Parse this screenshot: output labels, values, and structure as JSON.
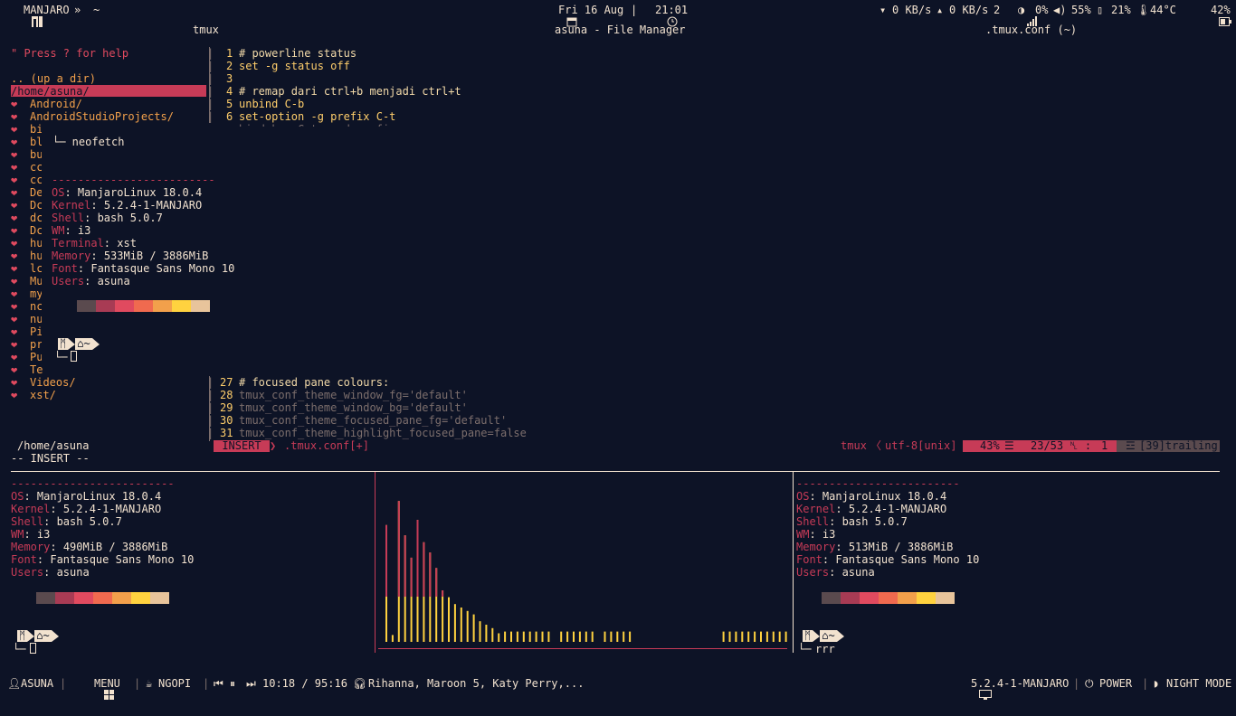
{
  "topbar": {
    "logo": "MANJARO",
    "chevrons": "»",
    "home": "~",
    "date": "Fri 16 Aug",
    "time": "21:01",
    "down_rate": "0 KB/s",
    "up_rate": "0 KB/s",
    "wifi_num": "2",
    "cpu": "0%",
    "volume": "55%",
    "mem": "21%",
    "temp": "44°C",
    "battery": "42%"
  },
  "titles": {
    "left": "tmux",
    "center": "asuna - File Manager",
    "right": ".tmux.conf (~)"
  },
  "file_manager": {
    "help": "\" Press ? for help",
    "updir": ".. (up a dir)",
    "current": "/home/asuna/",
    "entries": [
      "Android/",
      "AndroidStudioProjects/",
      "bi",
      "bl",
      "bu",
      "cc",
      "cc",
      "De",
      "Dc",
      "dc",
      "Dc",
      "hu",
      "hu",
      "lc",
      "Mu",
      "my",
      "nc",
      "nu",
      "Pi",
      "pr",
      "Pu",
      "Te",
      "Videos/",
      "xst/"
    ],
    "footer": "/home/asuna",
    "mode": "-- INSERT --"
  },
  "neofetch_popup": {
    "header": "└─ neofetch",
    "dashes": "-------------------------",
    "rows": [
      {
        "k": "OS",
        "v": "ManjaroLinux 18.0.4"
      },
      {
        "k": "Kernel",
        "v": "5.2.4-1-MANJARO"
      },
      {
        "k": "Shell",
        "v": "bash 5.0.7"
      },
      {
        "k": "WM",
        "v": "i3"
      },
      {
        "k": "Terminal",
        "v": "xst"
      },
      {
        "k": "Memory",
        "v": "533MiB / 3886MiB"
      },
      {
        "k": "Font",
        "v": "Fantasque Sans Mono 10"
      },
      {
        "k": "Users",
        "v": "asuna"
      }
    ],
    "prompt_home": "~",
    "prompt_line": "└─"
  },
  "editor": {
    "lines_top": [
      {
        "n": "1",
        "t": "# powerline status"
      },
      {
        "n": "2",
        "t": "set -g status off"
      },
      {
        "n": "3",
        "t": ""
      },
      {
        "n": "4",
        "t": "# remap dari ctrl+b menjadi ctrl+t"
      },
      {
        "n": "5",
        "t": "unbind C-b"
      },
      {
        "n": "6",
        "t": "set-option -g prefix C-t"
      }
    ],
    "lines_bottom": [
      {
        "n": "27",
        "t": "# focused pane colours:"
      },
      {
        "n": "28",
        "t": "tmux_conf_theme_window_fg='default'"
      },
      {
        "n": "29",
        "t": "tmux_conf_theme_window_bg='default'"
      },
      {
        "n": "30",
        "t": "tmux_conf_theme_focused_pane_fg='default'"
      },
      {
        "n": "31",
        "t": "tmux_conf_theme_highlight_focused_pane=false"
      }
    ],
    "status_mode": "INSERT",
    "status_file": ".tmux.conf[+]",
    "status_ft": "tmux",
    "status_enc": "utf-8[unix]",
    "status_pct": "43%",
    "status_pos": "23/53",
    "status_col": "1",
    "status_trailing": "[39]trailing"
  },
  "pane_left": {
    "dashes": "-------------------------",
    "rows": [
      {
        "k": "OS",
        "v": "ManjaroLinux 18.0.4"
      },
      {
        "k": "Kernel",
        "v": "5.2.4-1-MANJARO"
      },
      {
        "k": "Shell",
        "v": "bash 5.0.7"
      },
      {
        "k": "WM",
        "v": "i3"
      },
      {
        "k": "Memory",
        "v": "490MiB / 3886MiB"
      },
      {
        "k": "Font",
        "v": "Fantasque Sans Mono 10"
      },
      {
        "k": "Users",
        "v": "asuna"
      }
    ],
    "prompt_home": "~",
    "prompt_line": "└─"
  },
  "pane_right": {
    "dashes": "-------------------------",
    "rows": [
      {
        "k": "OS",
        "v": "ManjaroLinux 18.0.4"
      },
      {
        "k": "Kernel",
        "v": "5.2.4-1-MANJARO"
      },
      {
        "k": "Shell",
        "v": "bash 5.0.7"
      },
      {
        "k": "WM",
        "v": "i3"
      },
      {
        "k": "Memory",
        "v": "513MiB / 3886MiB"
      },
      {
        "k": "Font",
        "v": "Fantasque Sans Mono 10"
      },
      {
        "k": "Users",
        "v": "asuna"
      }
    ],
    "prompt_home": "~",
    "prompt_line": "└─",
    "command": "rrr"
  },
  "visualizer_levels": [
    0.68,
    0.04,
    0.82,
    0.62,
    0.49,
    0.71,
    0.58,
    0.52,
    0.43,
    0.3,
    0.26,
    0.22,
    0.2,
    0.18,
    0.16,
    0.12,
    0.1,
    0.08,
    0.05,
    0.06,
    0.06,
    0.06,
    0.06,
    0.06,
    0.06,
    0.06,
    0.06,
    0.0,
    0.06,
    0.06,
    0.06,
    0.06,
    0.06,
    0.06,
    0.0,
    0.06,
    0.06,
    0.06,
    0.06,
    0.06,
    0.0,
    0.0,
    0.0,
    0.0,
    0.0,
    0.0,
    0.0,
    0.0,
    0.0,
    0.0,
    0.0,
    0.0,
    0.0,
    0.0,
    0.06,
    0.06,
    0.06,
    0.06,
    0.06,
    0.06,
    0.06,
    0.06,
    0.06,
    0.06,
    0.06
  ],
  "palette": [
    "#5a4a4e",
    "#a83b54",
    "#e04a5f",
    "#f06a4f",
    "#f2a04b",
    "#ffd23f",
    "#e8c49b"
  ],
  "bottombar": {
    "user": "ASUNA",
    "menu": "MENU",
    "app": "NGOPI",
    "track_time": "10:18 / 95:16",
    "track": "Rihanna, Maroon 5, Katy Perry,...",
    "kernel": "5.2.4-1-MANJARO",
    "power": "POWER",
    "night": "NIGHT MODE"
  },
  "colors": {
    "bg": "#0d1326",
    "accent": "#c73b57",
    "fg": "#f2e2cf",
    "yellow": "#ffd23f"
  }
}
